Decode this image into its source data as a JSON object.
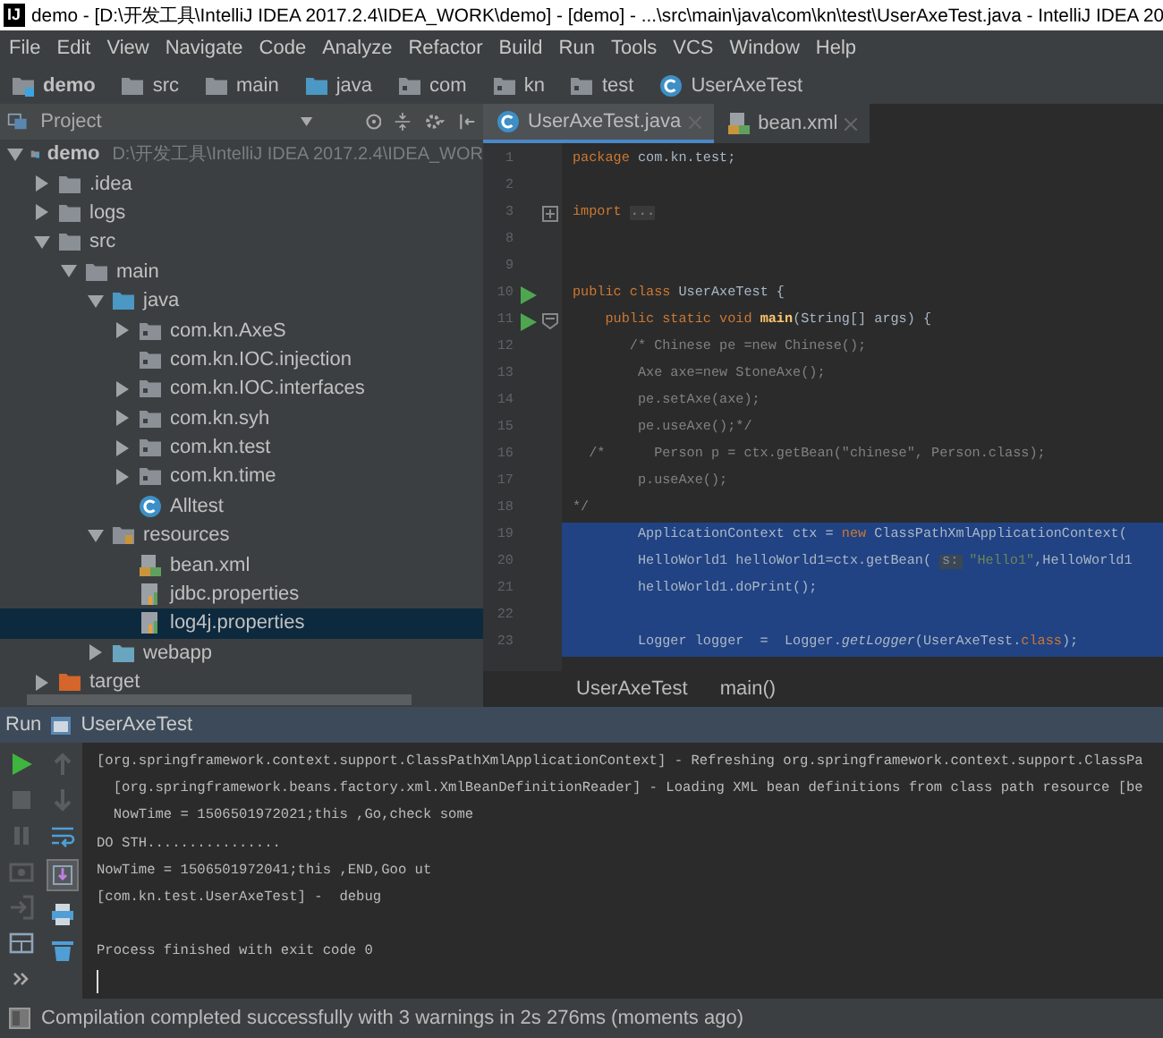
{
  "window": {
    "logo": "IJ",
    "title": "demo - [D:\\开发工具\\IntelliJ IDEA 2017.2.4\\IDEA_WORK\\demo] - [demo] - ...\\src\\main\\java\\com\\kn\\test\\UserAxeTest.java - IntelliJ IDEA 20"
  },
  "menu": [
    "File",
    "Edit",
    "View",
    "Navigate",
    "Code",
    "Analyze",
    "Refactor",
    "Build",
    "Run",
    "Tools",
    "VCS",
    "Window",
    "Help"
  ],
  "breadcrumb": [
    {
      "label": "demo",
      "kind": "module"
    },
    {
      "label": "src",
      "kind": "folder"
    },
    {
      "label": "main",
      "kind": "folder"
    },
    {
      "label": "java",
      "kind": "source-folder"
    },
    {
      "label": "com",
      "kind": "package"
    },
    {
      "label": "kn",
      "kind": "package"
    },
    {
      "label": "test",
      "kind": "package"
    },
    {
      "label": "UserAxeTest",
      "kind": "class"
    }
  ],
  "project": {
    "title": "Project",
    "tree": [
      {
        "label": "demo",
        "path": "D:\\开发工具\\IntelliJ IDEA 2017.2.4\\IDEA_WOR",
        "kind": "module",
        "expanded": true,
        "selected": false,
        "children": [
          {
            "label": ".idea",
            "kind": "folder",
            "expanded": false,
            "selected": false
          },
          {
            "label": "logs",
            "kind": "folder",
            "expanded": false,
            "selected": false
          },
          {
            "label": "src",
            "kind": "folder",
            "expanded": true,
            "selected": false,
            "children": [
              {
                "label": "main",
                "kind": "folder",
                "expanded": true,
                "selected": false,
                "children": [
                  {
                    "label": "java",
                    "kind": "source-folder",
                    "expanded": true,
                    "selected": false,
                    "children": [
                      {
                        "label": "com.kn.AxeS",
                        "kind": "package",
                        "expanded": false,
                        "selected": false
                      },
                      {
                        "label": "com.kn.IOC.injection",
                        "kind": "package",
                        "selected": false
                      },
                      {
                        "label": "com.kn.IOC.interfaces",
                        "kind": "package",
                        "expanded": false,
                        "selected": false
                      },
                      {
                        "label": "com.kn.syh",
                        "kind": "package",
                        "expanded": false,
                        "selected": false
                      },
                      {
                        "label": "com.kn.test",
                        "kind": "package",
                        "expanded": false,
                        "selected": false
                      },
                      {
                        "label": "com.kn.time",
                        "kind": "package",
                        "expanded": false,
                        "selected": false
                      },
                      {
                        "label": "Alltest",
                        "kind": "class",
                        "selected": false
                      }
                    ]
                  },
                  {
                    "label": "resources",
                    "kind": "resources-folder",
                    "expanded": true,
                    "selected": false,
                    "children": [
                      {
                        "label": "bean.xml",
                        "kind": "xml",
                        "selected": false
                      },
                      {
                        "label": "jdbc.properties",
                        "kind": "properties",
                        "selected": false
                      },
                      {
                        "label": "log4j.properties",
                        "kind": "properties",
                        "selected": true
                      }
                    ]
                  },
                  {
                    "label": "webapp",
                    "kind": "web-folder",
                    "expanded": false,
                    "selected": false
                  }
                ]
              }
            ]
          },
          {
            "label": "target",
            "kind": "excluded-folder",
            "expanded": false,
            "selected": false
          }
        ]
      }
    ]
  },
  "tabs": [
    {
      "label": "UserAxeTest.java",
      "kind": "class",
      "selected": true
    },
    {
      "label": "bean.xml",
      "kind": "xml",
      "selected": false
    }
  ],
  "editor": {
    "lines": [
      {
        "number": "1",
        "run": false,
        "selected": false,
        "segments": [
          {
            "text": "package",
            "kind": "kw"
          },
          {
            "text": " com.kn.test;",
            "kind": "plain"
          }
        ]
      },
      {
        "number": "2",
        "run": false,
        "selected": false
      },
      {
        "number": "3",
        "run": false,
        "selected": false,
        "expanded": false,
        "segments": [
          {
            "text": "import",
            "kind": "kw"
          },
          {
            "text": "...",
            "kind": "folded"
          }
        ]
      },
      {
        "number": "8",
        "run": false,
        "selected": false
      },
      {
        "number": "9",
        "run": false,
        "selected": false
      },
      {
        "number": "10",
        "run": true,
        "selected": false,
        "segments": [
          {
            "text": "public class",
            "kind": "kw"
          },
          {
            "text": " UserAxeTest {",
            "kind": "plain"
          }
        ]
      },
      {
        "number": "11",
        "run": true,
        "selected": false,
        "expanded": true,
        "segments": [
          {
            "text": "    public static void",
            "kind": "kw"
          },
          {
            "text": " main",
            "kind": "method"
          },
          {
            "text": "(String[] args) {",
            "kind": "plain"
          }
        ]
      },
      {
        "number": "12",
        "run": false,
        "selected": false,
        "segments": [
          {
            "text": "       /* Chinese pe =new Chinese();",
            "kind": "comment"
          }
        ]
      },
      {
        "number": "13",
        "run": false,
        "selected": false,
        "segments": [
          {
            "text": "        Axe axe=new StoneAxe();",
            "kind": "comment"
          }
        ]
      },
      {
        "number": "14",
        "run": false,
        "selected": false,
        "segments": [
          {
            "text": "        pe.setAxe(axe);",
            "kind": "comment"
          }
        ]
      },
      {
        "number": "15",
        "run": false,
        "selected": false,
        "segments": [
          {
            "text": "        pe.useAxe();*/",
            "kind": "comment"
          }
        ]
      },
      {
        "number": "16",
        "run": false,
        "selected": false,
        "segments": [
          {
            "text": "  /*      Person p = ctx.getBean(\"chinese\", Person.class);",
            "kind": "comment"
          }
        ]
      },
      {
        "number": "17",
        "run": false,
        "selected": false,
        "segments": [
          {
            "text": "        p.useAxe();",
            "kind": "comment"
          }
        ]
      },
      {
        "number": "18",
        "run": false,
        "selected": false,
        "segments": [
          {
            "text": "*/",
            "kind": "comment"
          }
        ]
      },
      {
        "number": "19",
        "run": false,
        "selected": true,
        "segments": [
          {
            "text": "        ApplicationContext ctx = ",
            "kind": "plain"
          },
          {
            "text": "new",
            "kind": "kw"
          },
          {
            "text": " ClassPathXmlApplicationContext(",
            "kind": "plain"
          }
        ]
      },
      {
        "number": "20",
        "run": false,
        "selected": true,
        "segments": [
          {
            "text": "        HelloWorld1 helloWorld1=ctx.getBean(",
            "kind": "plain"
          },
          {
            "text": "s:",
            "kind": "hint"
          },
          {
            "text": "\"Hello1\"",
            "kind": "str"
          },
          {
            "text": ",HelloWorld1",
            "kind": "plain"
          }
        ]
      },
      {
        "number": "21",
        "run": false,
        "selected": true,
        "segments": [
          {
            "text": "        helloWorld1.doPrint();",
            "kind": "plain"
          }
        ]
      },
      {
        "number": "22",
        "run": false,
        "selected": true
      },
      {
        "number": "23",
        "run": false,
        "selected": true,
        "segments": [
          {
            "text": "        Logger logger  =  Logger.",
            "kind": "plain"
          },
          {
            "text": "getLogger",
            "kind": "italic"
          },
          {
            "text": "(UserAxeTest.",
            "kind": "plain"
          },
          {
            "text": "class",
            "kind": "kw"
          },
          {
            "text": ");",
            "kind": "plain"
          }
        ]
      }
    ]
  },
  "editor_breadcrumb": [
    "UserAxeTest",
    "main()"
  ],
  "run": {
    "title": "Run",
    "config": "UserAxeTest",
    "output": [
      {
        "kind": "log",
        "text": "[org.springframework.context.support.ClassPathXmlApplicationContext] - Refreshing org.springframework.context.support.ClassPa"
      },
      {
        "kind": "log",
        "text": "  [org.springframework.beans.factory.xml.XmlBeanDefinitionReader] - Loading XML bean definitions from class path resource [be"
      },
      {
        "kind": "log",
        "text": "  NowTime = 1506501972021;this ,Go,check some"
      },
      {
        "kind": "log",
        "text": "DO STH................"
      },
      {
        "kind": "log",
        "text": "NowTime = 1506501972041;this ,END,Goo ut"
      },
      {
        "kind": "log",
        "text": "[com.kn.test.UserAxeTest] -  debug"
      },
      {
        "kind": "exit",
        "text": "Process finished with exit code 0"
      }
    ]
  },
  "status": "Compilation completed successfully with 3 warnings in 2s 276ms (moments ago)"
}
